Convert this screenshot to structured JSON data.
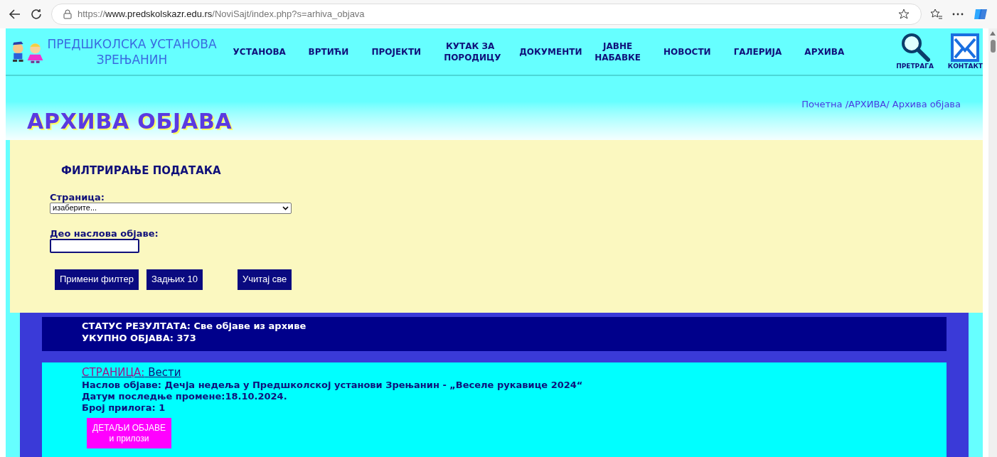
{
  "browser": {
    "url_prefix": "https://",
    "url_host": "www.predskolskazr.edu.rs",
    "url_path": "/NoviSajt/index.php?s=arhiva_objava"
  },
  "site": {
    "title_line1": "ПРЕДШКОЛСКА УСТАНОВА",
    "title_line2": "ЗРЕЊАНИН"
  },
  "nav": [
    {
      "label": "УСТАНОВА"
    },
    {
      "label": "ВРТИЋИ"
    },
    {
      "label": "ПРОЈЕКТИ"
    },
    {
      "label": "КУТАК ЗА ПОРОДИЦУ"
    },
    {
      "label": "ДОКУМЕНТИ"
    },
    {
      "label": "ЈАВНЕ НАБАВКЕ"
    },
    {
      "label": "НОВОСТИ"
    },
    {
      "label": "ГАЛЕРИЈА"
    },
    {
      "label": "АРХИВА"
    }
  ],
  "tools": [
    {
      "kind": "search",
      "label": "ПРЕТРАГА"
    },
    {
      "kind": "contact",
      "label": "КОНТАКТ"
    }
  ],
  "breadcrumb": "Почетна /АРХИВА/ Архива објава",
  "page_title": "АРХИВА ОБЈАВА",
  "filter": {
    "heading": "ФИЛТРИРАЊЕ ПОДАТАКА",
    "page_label": "Страница:",
    "page_value": "изаберите...",
    "title_label": "Део наслова објаве:",
    "buttons": [
      "Примени филтер",
      "Задњих 10",
      "Учитај све"
    ]
  },
  "status": {
    "line1": "СТАТУС РЕЗУЛТАТА: Све објаве из архиве",
    "line2": "УКУПНО ОБЈАВА: 373"
  },
  "posts": [
    {
      "page_label": "СТРАНИЦА:",
      "page_value": "Вести",
      "title": "Наслов објаве: Дечја недеља у Предшколској установи Зрењанин - „Веселе рукавице 2024“",
      "date": "Датум последње промене:18.10.2024.",
      "attachments": "Број прилога: 1",
      "button_line1": "ДЕТАЉИ ОБЈАВЕ",
      "button_line2": "и прилози"
    }
  ]
}
